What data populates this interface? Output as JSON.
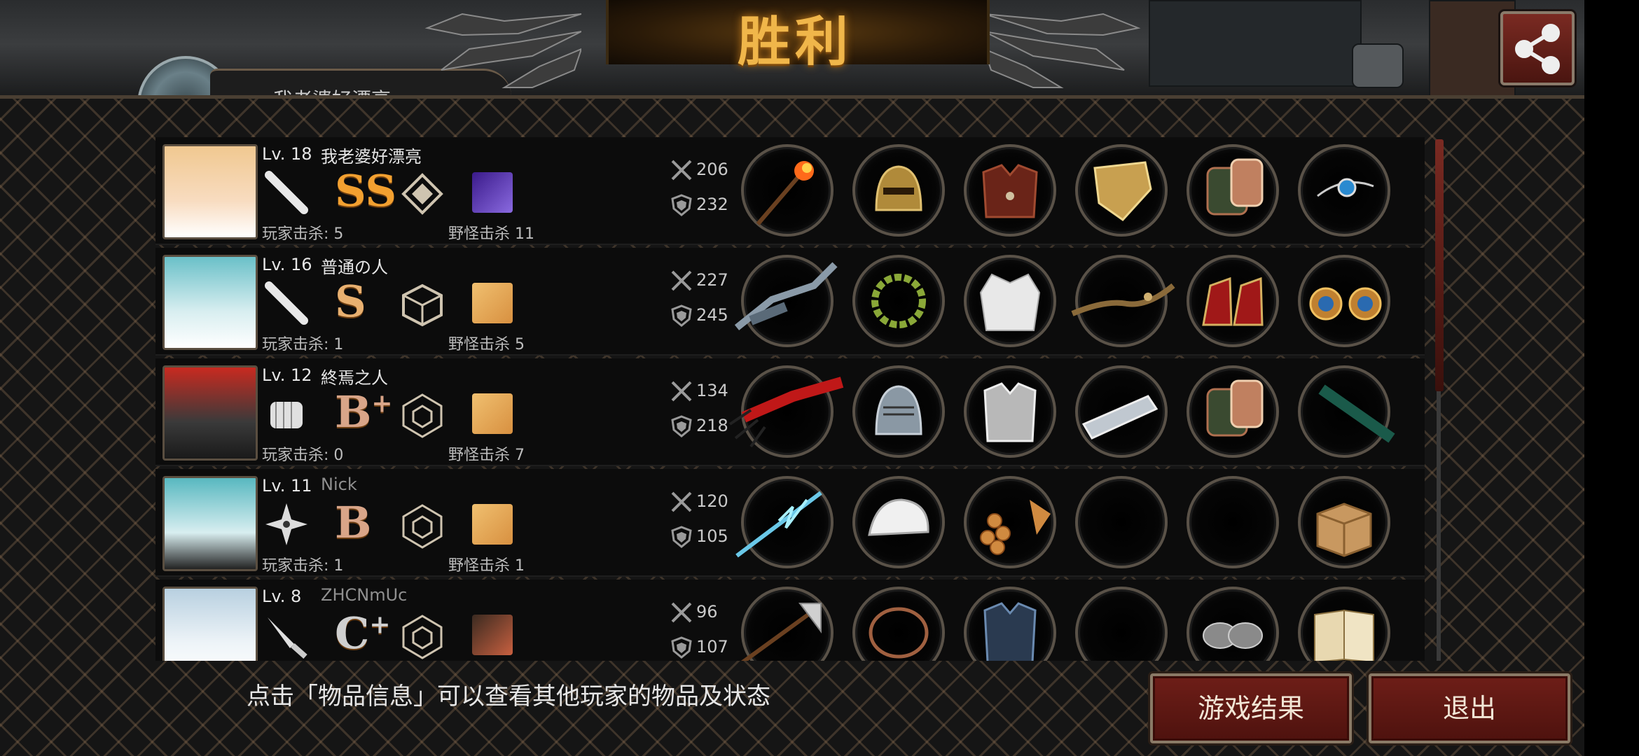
{
  "title": "胜利",
  "top_hidden_name": "我老婆好漂亮",
  "players": [
    {
      "level": "Lv. 18",
      "name": "我老婆好漂亮",
      "grade": "SS",
      "grade_plus": "",
      "player_kills": "玩家击杀: 5",
      "monster_kills": "野怪击杀 11",
      "attack": "206",
      "defense": "232",
      "weapon": "bat-icon",
      "rank": "diamond-rank-icon",
      "pet": "purple-pet-icon",
      "items": [
        "torch-icon",
        "golden-helmet-icon",
        "leather-armor-icon",
        "gold-shield-icon",
        "bracer-icon",
        "amulet-icon"
      ]
    },
    {
      "level": "Lv. 16",
      "name": "普通の人",
      "grade": "S",
      "grade_plus": "",
      "player_kills": "玩家击杀: 1",
      "monster_kills": "野怪击杀 5",
      "attack": "227",
      "defense": "245",
      "weapon": "bat-icon",
      "rank": "cube-rank-icon",
      "pet": "default-pet-icon",
      "items": [
        "chain-weapon-icon",
        "laurel-wreath-icon",
        "white-dress-icon",
        "wooden-staff-icon",
        "red-heels-icon",
        "earrings-icon"
      ]
    },
    {
      "level": "Lv. 12",
      "name": "終焉之人",
      "grade": "B",
      "grade_plus": "+",
      "player_kills": "玩家击杀: 0",
      "monster_kills": "野怪击杀 7",
      "attack": "134",
      "defense": "218",
      "weapon": "fist-icon",
      "rank": "hexagon-rank-icon",
      "pet": "default-pet-icon",
      "items": [
        "red-claw-icon",
        "steel-helmet-icon",
        "plate-armor-icon",
        "silver-bracer-icon",
        "bracer-icon",
        "baton-icon"
      ]
    },
    {
      "level": "Lv. 11",
      "name": "Nick",
      "grade": "B",
      "grade_plus": "",
      "player_kills": "玩家击杀: 1",
      "monster_kills": "野怪击杀 1",
      "attack": "120",
      "defense": "105",
      "weapon": "shuriken-icon",
      "rank": "hexagon-rank-icon",
      "pet": "default-pet-icon",
      "items": [
        "lightning-spear-icon",
        "bike-helmet-icon",
        "grape-armor-icon",
        "empty",
        "empty",
        "cardboard-box-icon"
      ]
    },
    {
      "level": "Lv. 8",
      "name": "ZHCNmUc",
      "grade": "C",
      "grade_plus": "+",
      "player_kills": "",
      "monster_kills": "",
      "attack": "96",
      "defense": "107",
      "weapon": "knife-icon",
      "rank": "hexagon-rank-icon",
      "pet": "goggles-pet-icon",
      "items": [
        "axe-icon",
        "bracelet-icon",
        "blue-armor-icon",
        "empty",
        "slippers-icon",
        "book-icon"
      ]
    }
  ],
  "hint": "点击「物品信息」可以查看其他玩家的物品及状态",
  "buttons": {
    "result": "游戏结果",
    "exit": "退出"
  },
  "colors": {
    "title": "#f0b64a",
    "button": "#5e1814",
    "accent": "#e8b070"
  }
}
